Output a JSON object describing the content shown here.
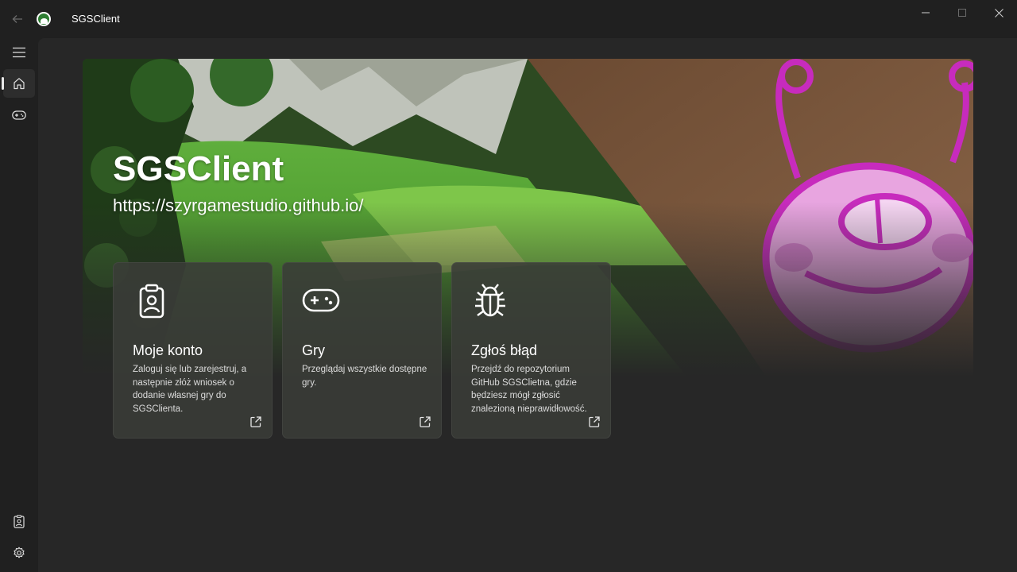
{
  "window": {
    "title": "SGSClient"
  },
  "icons": {
    "back": "back-arrow-icon",
    "app": "app-logo-icon",
    "minimize": "minimize-icon",
    "maximize": "maximize-icon",
    "close": "close-icon",
    "menu": "hamburger-menu-icon",
    "home": "home-icon",
    "games": "gamepad-icon",
    "account": "id-badge-icon",
    "settings": "gear-icon",
    "external": "external-link-icon",
    "bug": "bug-icon"
  },
  "hero": {
    "title": "SGSClient",
    "url": "https://szyrgamestudio.github.io/"
  },
  "cards": [
    {
      "title": "Moje konto",
      "description": "Zaloguj się lub zarejestruj, a następnie złóż wniosek o dodanie własnej gry do SGSClienta."
    },
    {
      "title": "Gry",
      "description": "Przeglądaj wszystkie dostępne gry."
    },
    {
      "title": "Zgłoś błąd",
      "description": "Przejdź do repozytorium GitHub SGSClietna, gdzie będziesz mógł zgłosić znalezioną nieprawidłowość."
    }
  ],
  "colors": {
    "background": "#202020",
    "content": "#272727",
    "card": "#3a3c38",
    "accent_pink": "#d43fc4"
  }
}
